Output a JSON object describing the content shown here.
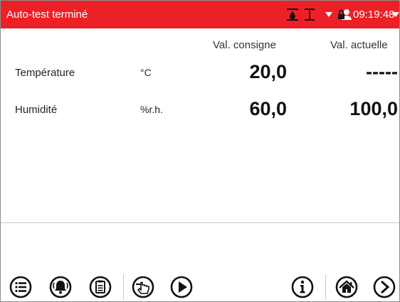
{
  "header": {
    "title": "Auto-test terminé",
    "time": "09:19:48",
    "bg_color": "#ee2027"
  },
  "columns": {
    "setpoint": "Val. consigne",
    "actual": "Val. actuelle"
  },
  "rows": [
    {
      "label": "Température",
      "unit": "°C",
      "setpoint": "20,0",
      "actual": "-----"
    },
    {
      "label": "Humidité",
      "unit": "%r.h.",
      "setpoint": "60,0",
      "actual": "100,0"
    }
  ],
  "toolbar": {
    "icons": [
      "menu-icon",
      "alarm-bell-icon",
      "clipboard-icon",
      "touch-hand-icon",
      "play-icon",
      "info-icon",
      "home-icon",
      "next-arrow-icon"
    ]
  }
}
